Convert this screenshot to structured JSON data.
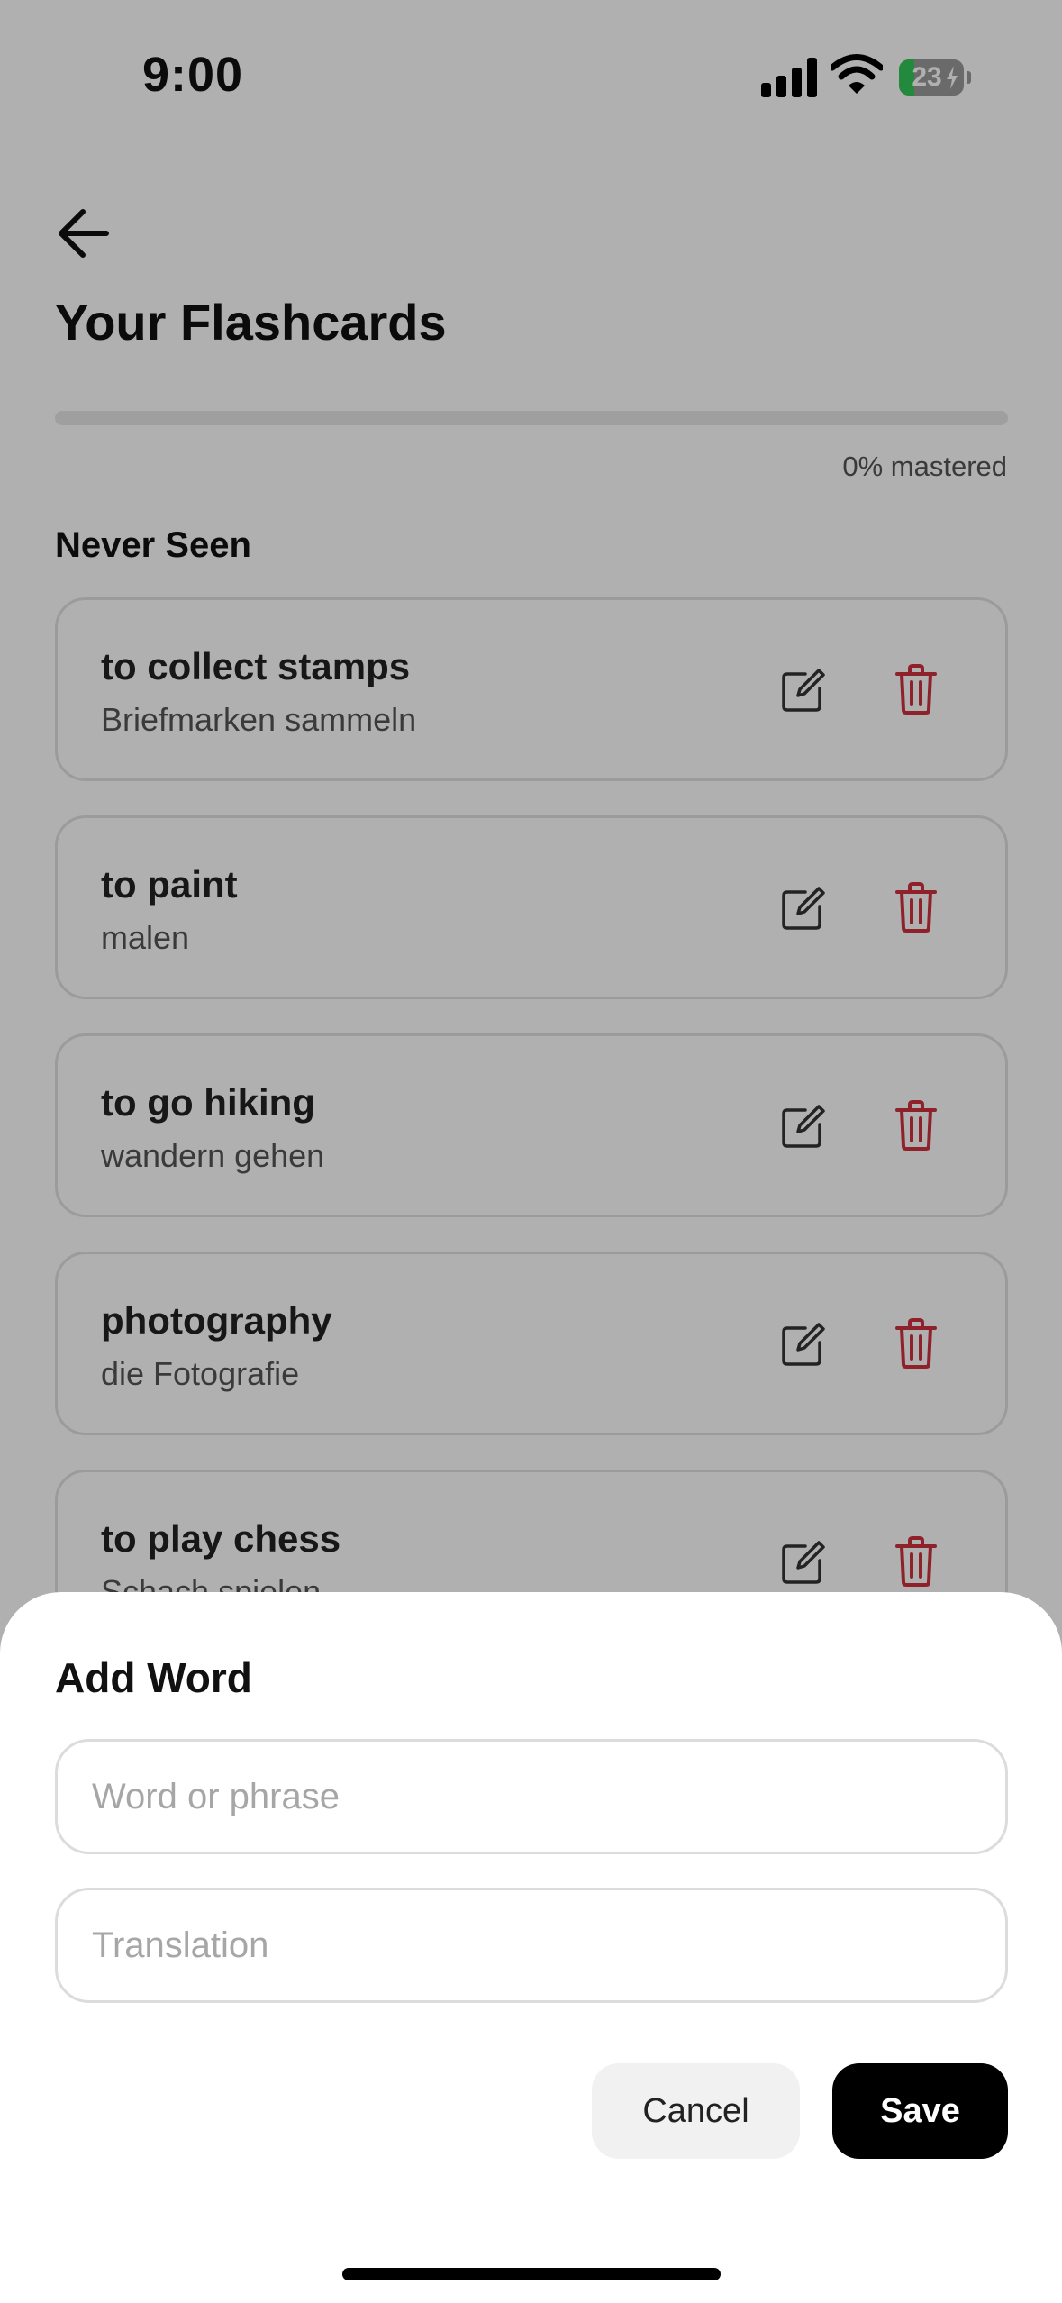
{
  "status_bar": {
    "time": "9:00",
    "battery_level": "23",
    "battery_fraction": 0.23,
    "icons": [
      "cellular-signal-icon",
      "wifi-icon",
      "battery-charging-icon"
    ]
  },
  "header": {
    "back_icon": "arrow-left-icon",
    "title": "Your Flashcards"
  },
  "progress": {
    "fraction": 0,
    "label": "0% mastered"
  },
  "section": {
    "title": "Never Seen"
  },
  "cards": [
    {
      "word": "to collect stamps",
      "translation": "Briefmarken sammeln"
    },
    {
      "word": "to paint",
      "translation": "malen"
    },
    {
      "word": "to go hiking",
      "translation": "wandern gehen"
    },
    {
      "word": "photography",
      "translation": "die Fotografie"
    },
    {
      "word": "to play chess",
      "translation": "Schach spielen"
    }
  ],
  "card_actions": {
    "edit_icon": "edit-icon",
    "delete_icon": "trash-icon"
  },
  "sheet": {
    "title": "Add Word",
    "word_placeholder": "Word or phrase",
    "word_value": "",
    "translation_placeholder": "Translation",
    "translation_value": "",
    "cancel_label": "Cancel",
    "save_label": "Save"
  },
  "colors": {
    "accent": "#000000",
    "delete": "#d0313d",
    "battery_fill": "#34c759",
    "overlay": "rgba(0,0,0,0.31)"
  }
}
